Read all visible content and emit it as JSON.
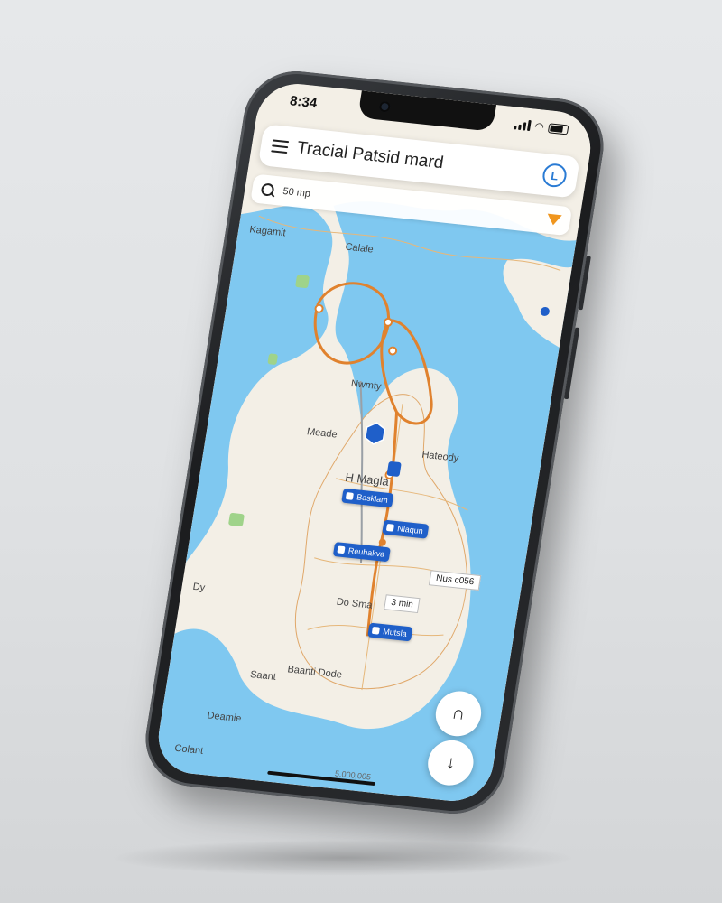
{
  "status_bar": {
    "time": "8:34"
  },
  "header": {
    "title": "Tracial Patsid mard",
    "clock_icon_glyph": "L"
  },
  "search": {
    "text": "50 mp"
  },
  "map": {
    "labels": {
      "kangamit": "Kagamit",
      "calale": "Calale",
      "nwmty": "Nwmty",
      "meade": "Meade",
      "hateody": "Hateody",
      "h_magla": "H Magla",
      "dy": "Dy",
      "do_smu": "Do Sma",
      "bsant_dode": "Baanti Dode",
      "saant": "Saant",
      "dearnie": "Deamie",
      "colant": "Colant"
    },
    "chips": [
      {
        "label": "Basklam"
      },
      {
        "label": "Nlaqun"
      },
      {
        "label": "Reuhakva"
      },
      {
        "label": "Mutsla"
      }
    ],
    "info_boxes": {
      "eta": "Nus c056",
      "duration": "3 min"
    },
    "scale": "5,000,005"
  },
  "controls": {
    "navigate_glyph": "∩",
    "recenter_glyph": "↓"
  },
  "colors": {
    "water": "#7fc8f0",
    "land": "#f3efe6",
    "route": "#e0822e",
    "transit": "#1f5fc9"
  }
}
